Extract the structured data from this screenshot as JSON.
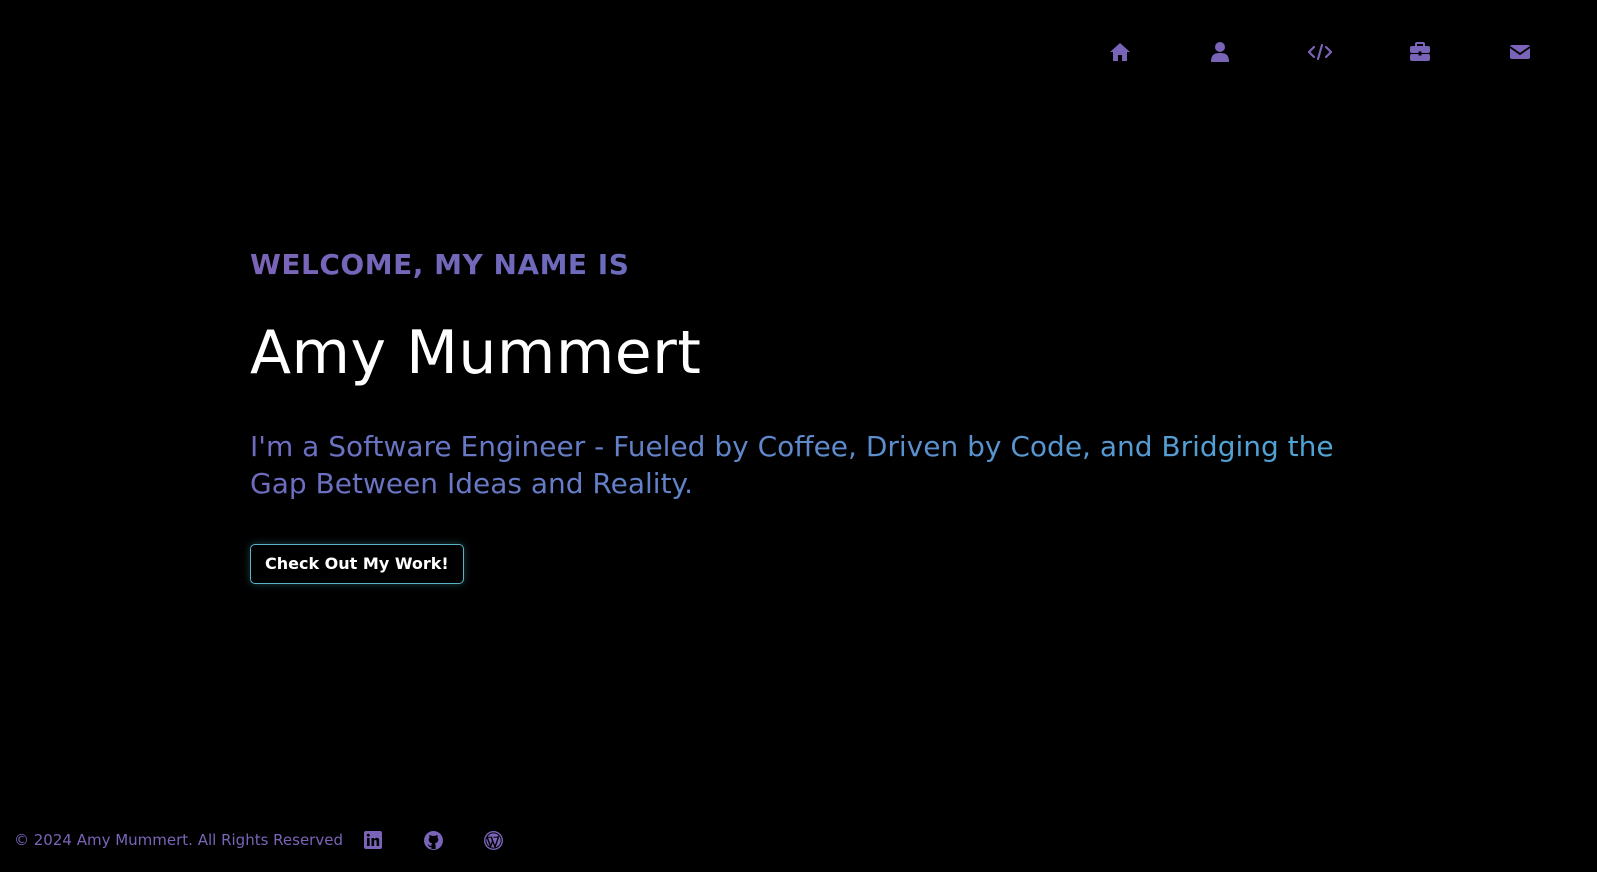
{
  "nav": {
    "items": [
      {
        "icon": "home-icon",
        "label": "Home"
      },
      {
        "icon": "user-icon",
        "label": "About"
      },
      {
        "icon": "code-icon",
        "label": "Projects"
      },
      {
        "icon": "briefcase-icon",
        "label": "Experience"
      },
      {
        "icon": "envelope-icon",
        "label": "Contact"
      }
    ],
    "color": "#7a64b8"
  },
  "hero": {
    "greeting": "WELCOME, MY NAME IS",
    "name": "Amy Mummert",
    "tagline": "I'm a Software Engineer - Fueled by Coffee, Driven by Code, and Bridging the Gap Between Ideas and Reality.",
    "cta_label": "Check Out My Work!"
  },
  "footer": {
    "copyright": "© 2024 Amy Mummert. All Rights Reserved",
    "social": [
      {
        "icon": "linkedin-icon"
      },
      {
        "icon": "github-icon"
      },
      {
        "icon": "wordpress-icon"
      }
    ]
  },
  "colors": {
    "background": "#000000",
    "accent_purple": "#7a64b8",
    "accent_blue": "#4ea6d6",
    "button_border": "#5ab4c8",
    "text_white": "#ffffff"
  }
}
